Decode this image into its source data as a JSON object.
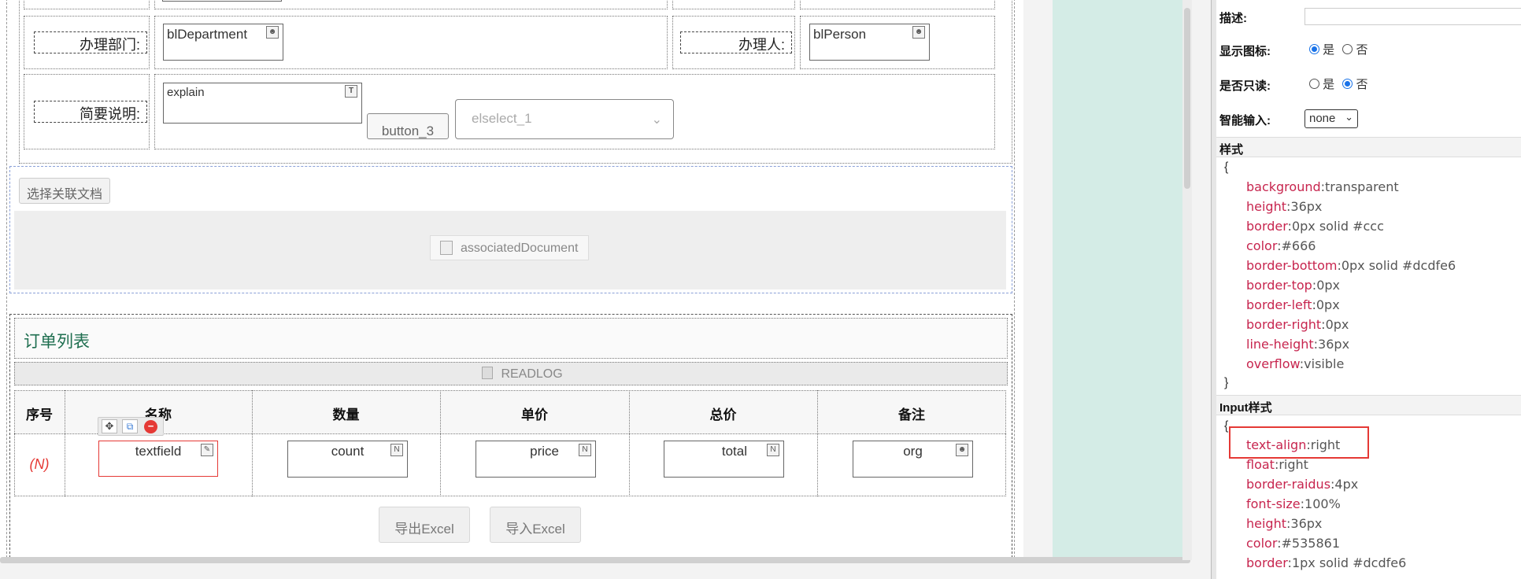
{
  "form": {
    "row_dept": {
      "label": "办理部门:",
      "field_value": "blDepartment"
    },
    "row_person": {
      "label": "办理人:",
      "field_value": "blPerson"
    },
    "row_explain": {
      "label": "简要说明:",
      "field_value": "explain",
      "button_label": "button_3",
      "select_placeholder": "elselect_1"
    }
  },
  "associated": {
    "select_button": "选择关联文档",
    "doc_label": "associatedDocument"
  },
  "order": {
    "title": "订单列表",
    "readlog": "READLOG",
    "headers": [
      "序号",
      "名称",
      "数量",
      "单价",
      "总价",
      "备注"
    ],
    "row": {
      "index": "(N)",
      "name": "textfield",
      "count": "count",
      "price": "price",
      "total": "total",
      "org": "org"
    },
    "export_button": "导出Excel",
    "import_button": "导入Excel"
  },
  "props": {
    "desc_label": "描述:",
    "show_icon_label": "显示图标:",
    "readonly_label": "是否只读:",
    "yes": "是",
    "no": "否",
    "smart_input_label": "智能输入:",
    "smart_input_value": "none",
    "style_section": "样式",
    "style_open": "{",
    "style_close": "}",
    "style_lines": [
      {
        "k": "background",
        "v": "transparent"
      },
      {
        "k": "height",
        "v": "36px"
      },
      {
        "k": "border",
        "v": "0px solid #ccc"
      },
      {
        "k": "color",
        "v": "#666"
      },
      {
        "k": "border-bottom",
        "v": "0px solid #dcdfe6"
      },
      {
        "k": "border-top",
        "v": "0px"
      },
      {
        "k": "border-left",
        "v": "0px"
      },
      {
        "k": "border-right",
        "v": "0px"
      },
      {
        "k": "line-height",
        "v": "36px"
      },
      {
        "k": "overflow",
        "v": "visible"
      }
    ],
    "input_section": "Input样式",
    "input_open": "{",
    "input_lines": [
      {
        "k": "text-align",
        "v": "right"
      },
      {
        "k": "float",
        "v": "right"
      },
      {
        "k": "border-raidus",
        "v": "4px"
      },
      {
        "k": "font-size",
        "v": "100%"
      },
      {
        "k": "height",
        "v": "36px"
      },
      {
        "k": "color",
        "v": "#535861"
      },
      {
        "k": "border",
        "v": "1px solid #dcdfe6"
      }
    ],
    "sep": ":"
  },
  "colors": {
    "accent_teal_panel": "#d4ece6",
    "selection_red": "#e53935",
    "css_key": "#c7254e"
  }
}
